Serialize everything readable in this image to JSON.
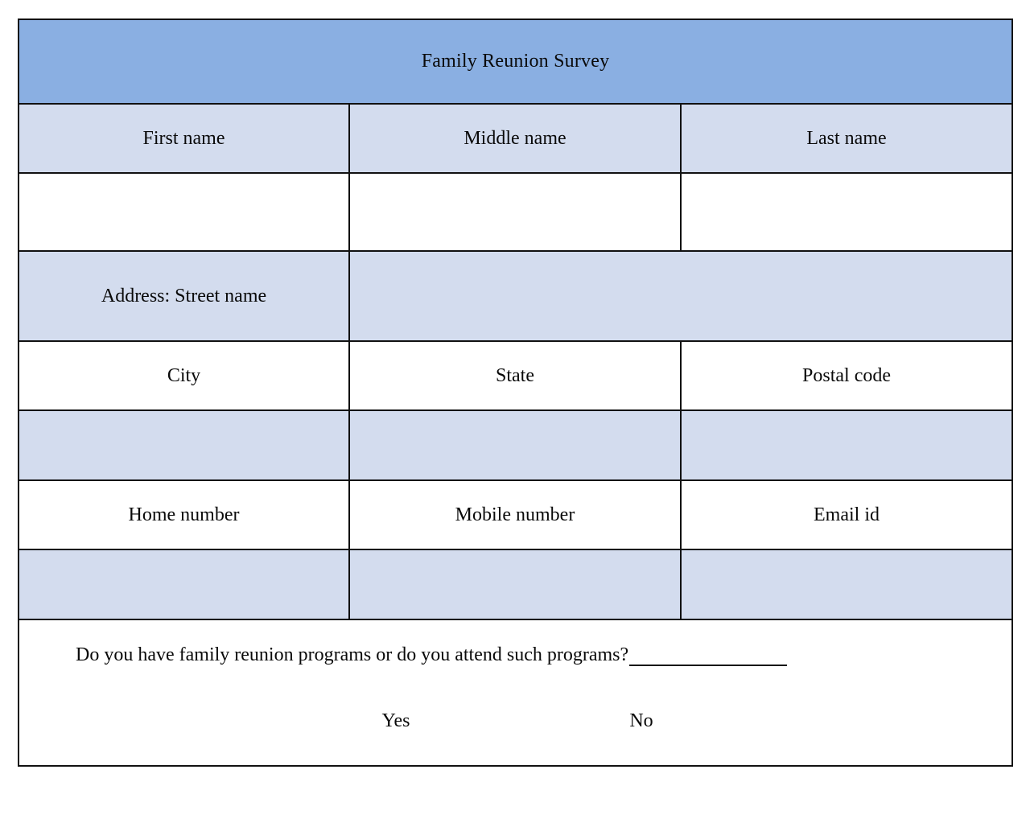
{
  "form": {
    "title": "Family Reunion Survey",
    "rows": {
      "name_labels": [
        "First name",
        "Middle name",
        "Last name"
      ],
      "name_values": [
        "",
        "",
        ""
      ],
      "address_label": "Address: Street name",
      "address_value": "",
      "location_labels": [
        "City",
        "State",
        "Postal code"
      ],
      "location_values": [
        "",
        "",
        ""
      ],
      "contact_labels": [
        "Home number",
        "Mobile number",
        "Email id"
      ],
      "contact_values": [
        "",
        "",
        ""
      ]
    },
    "question": {
      "text": "Do you have family reunion programs or do you attend such programs?",
      "answer_value": "",
      "options": [
        "Yes",
        "No"
      ]
    }
  },
  "colors": {
    "header_blue": "#8aafe2",
    "cell_blue": "#d3dcee",
    "cell_white": "#ffffff",
    "border": "#111111"
  }
}
